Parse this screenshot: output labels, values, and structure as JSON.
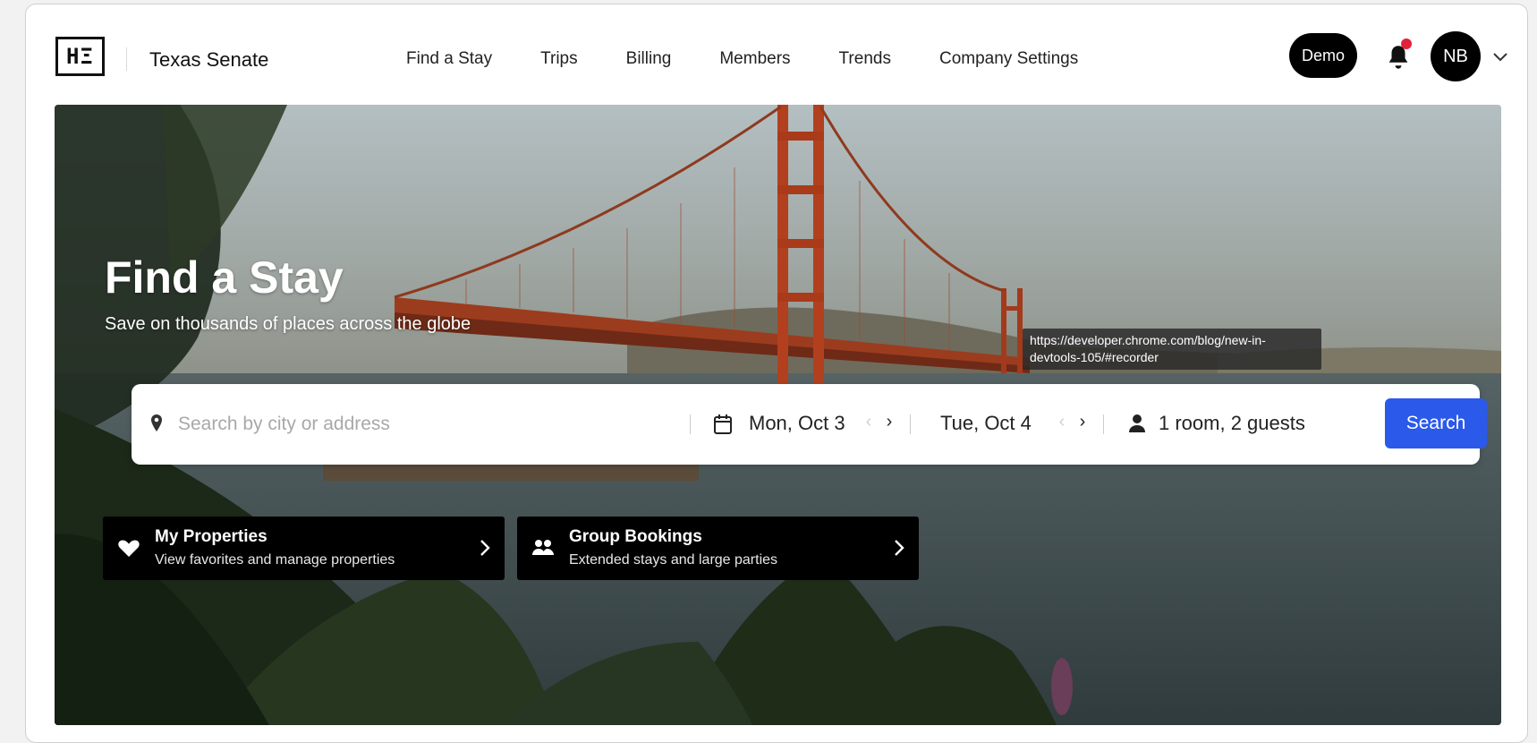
{
  "header": {
    "logo_text": "HΞ",
    "org_name": "Texas Senate",
    "nav": [
      {
        "label": "Find a Stay",
        "active": true
      },
      {
        "label": "Trips",
        "active": false
      },
      {
        "label": "Billing",
        "active": false
      },
      {
        "label": "Members",
        "active": false
      },
      {
        "label": "Trends",
        "active": false
      },
      {
        "label": "Company Settings",
        "active": false
      }
    ],
    "demo_label": "Demo",
    "notification_badge_color": "#e0233b",
    "avatar_initials": "NB"
  },
  "hero": {
    "title": "Find a Stay",
    "subtitle": "Save on thousands of places across the globe",
    "tooltip": "https://developer.chrome.com/blog/new-in-devtools-105/#recorder"
  },
  "search": {
    "placeholder": "Search by city or address",
    "check_in": "Mon, Oct 3",
    "check_out": "Tue, Oct 4",
    "guests": "1 room, 2 guests",
    "button_label": "Search",
    "button_color": "#2b59ea"
  },
  "cards": [
    {
      "title": "My Properties",
      "subtitle": "View favorites and manage properties",
      "icon": "heart-icon"
    },
    {
      "title": "Group Bookings",
      "subtitle": "Extended stays and large parties",
      "icon": "group-icon"
    }
  ]
}
